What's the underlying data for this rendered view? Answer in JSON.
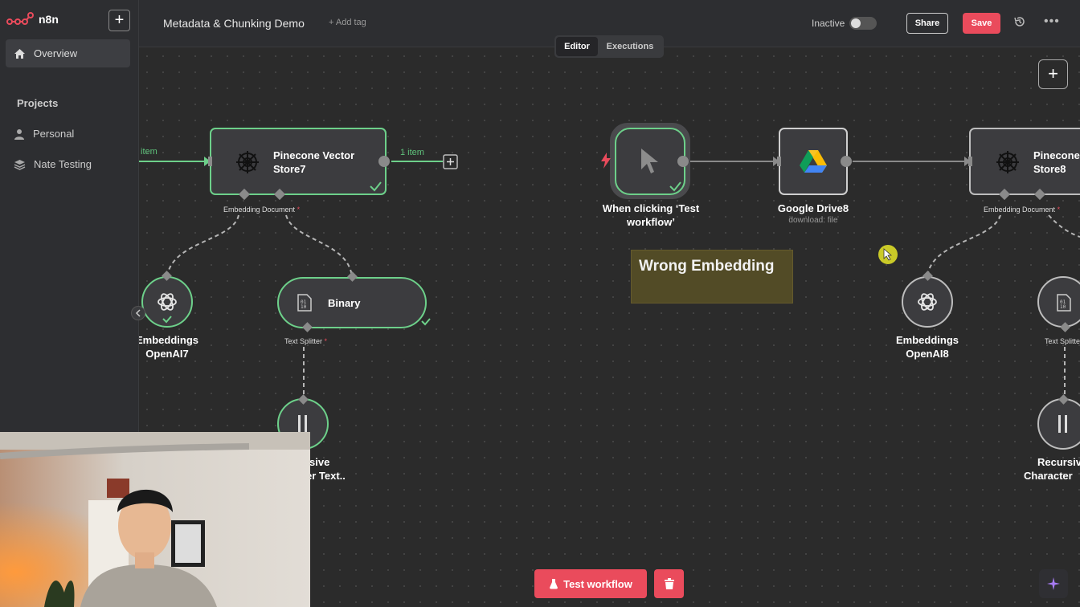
{
  "app": {
    "name": "n8n"
  },
  "sidebar": {
    "overview": "Overview",
    "projects_label": "Projects",
    "items": [
      {
        "label": "Personal",
        "icon": "user-icon"
      },
      {
        "label": "Nate Testing",
        "icon": "layers-icon"
      }
    ]
  },
  "header": {
    "title": "Metadata & Chunking Demo",
    "add_tag": "+ Add tag",
    "status_label": "Inactive",
    "share": "Share",
    "save": "Save",
    "more": "•••"
  },
  "tabs": {
    "editor": "Editor",
    "executions": "Executions"
  },
  "nodes": {
    "pinecone7": {
      "title_line1": "Pinecone Vector",
      "title_line2": "Store7",
      "port": "Embedding Document"
    },
    "embeddings7": {
      "line1": "Embeddings",
      "line2": "OpenAI7"
    },
    "binary": {
      "title": "Binary",
      "port": "Text Splitter"
    },
    "recursive7": {
      "line1": "sive",
      "line2": "er Text.."
    },
    "trigger": {
      "line1": "When clicking ‘Test",
      "line2": "workflow’"
    },
    "drive": {
      "title": "Google Drive8",
      "sub": "download: file"
    },
    "pinecone8": {
      "title_line1": "Pinecone",
      "title_line2": "Store8",
      "port": "Embedding Document"
    },
    "embeddings8": {
      "line1": "Embeddings",
      "line2": "OpenAI8"
    },
    "splitter8": {
      "port": "Text Splitter"
    },
    "recursive8": {
      "line1": "Recursiv",
      "line2": "Character"
    }
  },
  "edges": {
    "left_in": "item",
    "out_label": "1 item"
  },
  "sticky_note": {
    "text": "Wrong Embedding"
  },
  "footer": {
    "test_workflow": "Test workflow"
  },
  "colors": {
    "accent": "#ea4b5c",
    "success": "#6dd08a",
    "sticky": "#524b26"
  }
}
